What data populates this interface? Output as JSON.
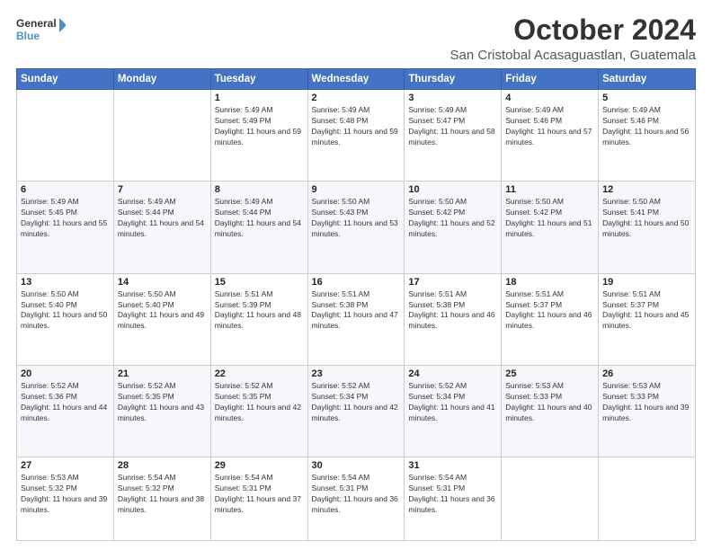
{
  "header": {
    "logo_general": "General",
    "logo_blue": "Blue",
    "month_title": "October 2024",
    "subtitle": "San Cristobal Acasaguastlan, Guatemala"
  },
  "weekdays": [
    "Sunday",
    "Monday",
    "Tuesday",
    "Wednesday",
    "Thursday",
    "Friday",
    "Saturday"
  ],
  "weeks": [
    [
      {
        "day": "",
        "info": ""
      },
      {
        "day": "",
        "info": ""
      },
      {
        "day": "1",
        "info": "Sunrise: 5:49 AM\nSunset: 5:49 PM\nDaylight: 11 hours and 59 minutes."
      },
      {
        "day": "2",
        "info": "Sunrise: 5:49 AM\nSunset: 5:48 PM\nDaylight: 11 hours and 59 minutes."
      },
      {
        "day": "3",
        "info": "Sunrise: 5:49 AM\nSunset: 5:47 PM\nDaylight: 11 hours and 58 minutes."
      },
      {
        "day": "4",
        "info": "Sunrise: 5:49 AM\nSunset: 5:46 PM\nDaylight: 11 hours and 57 minutes."
      },
      {
        "day": "5",
        "info": "Sunrise: 5:49 AM\nSunset: 5:46 PM\nDaylight: 11 hours and 56 minutes."
      }
    ],
    [
      {
        "day": "6",
        "info": "Sunrise: 5:49 AM\nSunset: 5:45 PM\nDaylight: 11 hours and 55 minutes."
      },
      {
        "day": "7",
        "info": "Sunrise: 5:49 AM\nSunset: 5:44 PM\nDaylight: 11 hours and 54 minutes."
      },
      {
        "day": "8",
        "info": "Sunrise: 5:49 AM\nSunset: 5:44 PM\nDaylight: 11 hours and 54 minutes."
      },
      {
        "day": "9",
        "info": "Sunrise: 5:50 AM\nSunset: 5:43 PM\nDaylight: 11 hours and 53 minutes."
      },
      {
        "day": "10",
        "info": "Sunrise: 5:50 AM\nSunset: 5:42 PM\nDaylight: 11 hours and 52 minutes."
      },
      {
        "day": "11",
        "info": "Sunrise: 5:50 AM\nSunset: 5:42 PM\nDaylight: 11 hours and 51 minutes."
      },
      {
        "day": "12",
        "info": "Sunrise: 5:50 AM\nSunset: 5:41 PM\nDaylight: 11 hours and 50 minutes."
      }
    ],
    [
      {
        "day": "13",
        "info": "Sunrise: 5:50 AM\nSunset: 5:40 PM\nDaylight: 11 hours and 50 minutes."
      },
      {
        "day": "14",
        "info": "Sunrise: 5:50 AM\nSunset: 5:40 PM\nDaylight: 11 hours and 49 minutes."
      },
      {
        "day": "15",
        "info": "Sunrise: 5:51 AM\nSunset: 5:39 PM\nDaylight: 11 hours and 48 minutes."
      },
      {
        "day": "16",
        "info": "Sunrise: 5:51 AM\nSunset: 5:38 PM\nDaylight: 11 hours and 47 minutes."
      },
      {
        "day": "17",
        "info": "Sunrise: 5:51 AM\nSunset: 5:38 PM\nDaylight: 11 hours and 46 minutes."
      },
      {
        "day": "18",
        "info": "Sunrise: 5:51 AM\nSunset: 5:37 PM\nDaylight: 11 hours and 46 minutes."
      },
      {
        "day": "19",
        "info": "Sunrise: 5:51 AM\nSunset: 5:37 PM\nDaylight: 11 hours and 45 minutes."
      }
    ],
    [
      {
        "day": "20",
        "info": "Sunrise: 5:52 AM\nSunset: 5:36 PM\nDaylight: 11 hours and 44 minutes."
      },
      {
        "day": "21",
        "info": "Sunrise: 5:52 AM\nSunset: 5:35 PM\nDaylight: 11 hours and 43 minutes."
      },
      {
        "day": "22",
        "info": "Sunrise: 5:52 AM\nSunset: 5:35 PM\nDaylight: 11 hours and 42 minutes."
      },
      {
        "day": "23",
        "info": "Sunrise: 5:52 AM\nSunset: 5:34 PM\nDaylight: 11 hours and 42 minutes."
      },
      {
        "day": "24",
        "info": "Sunrise: 5:52 AM\nSunset: 5:34 PM\nDaylight: 11 hours and 41 minutes."
      },
      {
        "day": "25",
        "info": "Sunrise: 5:53 AM\nSunset: 5:33 PM\nDaylight: 11 hours and 40 minutes."
      },
      {
        "day": "26",
        "info": "Sunrise: 5:53 AM\nSunset: 5:33 PM\nDaylight: 11 hours and 39 minutes."
      }
    ],
    [
      {
        "day": "27",
        "info": "Sunrise: 5:53 AM\nSunset: 5:32 PM\nDaylight: 11 hours and 39 minutes."
      },
      {
        "day": "28",
        "info": "Sunrise: 5:54 AM\nSunset: 5:32 PM\nDaylight: 11 hours and 38 minutes."
      },
      {
        "day": "29",
        "info": "Sunrise: 5:54 AM\nSunset: 5:31 PM\nDaylight: 11 hours and 37 minutes."
      },
      {
        "day": "30",
        "info": "Sunrise: 5:54 AM\nSunset: 5:31 PM\nDaylight: 11 hours and 36 minutes."
      },
      {
        "day": "31",
        "info": "Sunrise: 5:54 AM\nSunset: 5:31 PM\nDaylight: 11 hours and 36 minutes."
      },
      {
        "day": "",
        "info": ""
      },
      {
        "day": "",
        "info": ""
      }
    ]
  ]
}
